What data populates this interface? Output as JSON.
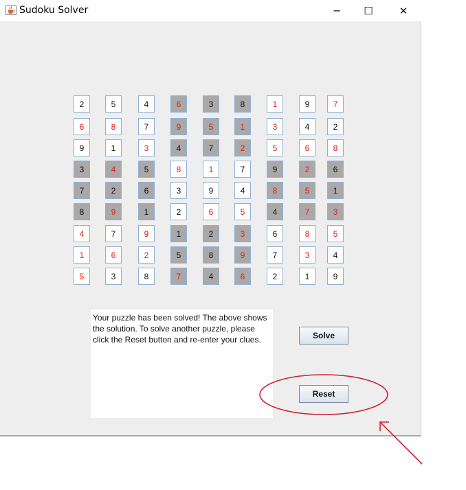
{
  "window": {
    "title": "Sudoku Solver",
    "controls": {
      "minimize": "─",
      "maximize": "☐",
      "close": "✕"
    }
  },
  "colors": {
    "given_digit": "#111111",
    "solved_digit": "#e0201c",
    "white_cell": "#ffffff",
    "gray_cell": "#a9a9a9",
    "annotation": "#d0202f"
  },
  "board": {
    "rows": [
      [
        {
          "v": "2",
          "shade": "w",
          "color": "black"
        },
        {
          "v": "5",
          "shade": "w",
          "color": "black"
        },
        {
          "v": "4",
          "shade": "w",
          "color": "black"
        },
        {
          "v": "6",
          "shade": "g",
          "color": "red"
        },
        {
          "v": "3",
          "shade": "g",
          "color": "black"
        },
        {
          "v": "8",
          "shade": "g",
          "color": "black"
        },
        {
          "v": "1",
          "shade": "w",
          "color": "red"
        },
        {
          "v": "9",
          "shade": "w",
          "color": "black"
        },
        {
          "v": "7",
          "shade": "w",
          "color": "red"
        }
      ],
      [
        {
          "v": "6",
          "shade": "w",
          "color": "red"
        },
        {
          "v": "8",
          "shade": "w",
          "color": "red"
        },
        {
          "v": "7",
          "shade": "w",
          "color": "black"
        },
        {
          "v": "9",
          "shade": "g",
          "color": "red"
        },
        {
          "v": "5",
          "shade": "g",
          "color": "red"
        },
        {
          "v": "1",
          "shade": "g",
          "color": "red"
        },
        {
          "v": "3",
          "shade": "w",
          "color": "red"
        },
        {
          "v": "4",
          "shade": "w",
          "color": "black"
        },
        {
          "v": "2",
          "shade": "w",
          "color": "black"
        }
      ],
      [
        {
          "v": "9",
          "shade": "w",
          "color": "black"
        },
        {
          "v": "1",
          "shade": "w",
          "color": "black"
        },
        {
          "v": "3",
          "shade": "w",
          "color": "red"
        },
        {
          "v": "4",
          "shade": "g",
          "color": "black"
        },
        {
          "v": "7",
          "shade": "g",
          "color": "black"
        },
        {
          "v": "2",
          "shade": "g",
          "color": "red"
        },
        {
          "v": "5",
          "shade": "w",
          "color": "red"
        },
        {
          "v": "6",
          "shade": "w",
          "color": "red"
        },
        {
          "v": "8",
          "shade": "w",
          "color": "red"
        }
      ],
      [
        {
          "v": "3",
          "shade": "g",
          "color": "black"
        },
        {
          "v": "4",
          "shade": "g",
          "color": "red"
        },
        {
          "v": "5",
          "shade": "g",
          "color": "black"
        },
        {
          "v": "8",
          "shade": "w",
          "color": "red"
        },
        {
          "v": "1",
          "shade": "w",
          "color": "red"
        },
        {
          "v": "7",
          "shade": "w",
          "color": "black"
        },
        {
          "v": "9",
          "shade": "g",
          "color": "black"
        },
        {
          "v": "2",
          "shade": "g",
          "color": "red"
        },
        {
          "v": "6",
          "shade": "g",
          "color": "black"
        }
      ],
      [
        {
          "v": "7",
          "shade": "g",
          "color": "black"
        },
        {
          "v": "2",
          "shade": "g",
          "color": "black"
        },
        {
          "v": "6",
          "shade": "g",
          "color": "black"
        },
        {
          "v": "3",
          "shade": "w",
          "color": "black"
        },
        {
          "v": "9",
          "shade": "w",
          "color": "black"
        },
        {
          "v": "4",
          "shade": "w",
          "color": "black"
        },
        {
          "v": "8",
          "shade": "g",
          "color": "red"
        },
        {
          "v": "5",
          "shade": "g",
          "color": "red"
        },
        {
          "v": "1",
          "shade": "g",
          "color": "black"
        }
      ],
      [
        {
          "v": "8",
          "shade": "g",
          "color": "black"
        },
        {
          "v": "9",
          "shade": "g",
          "color": "red"
        },
        {
          "v": "1",
          "shade": "g",
          "color": "black"
        },
        {
          "v": "2",
          "shade": "w",
          "color": "black"
        },
        {
          "v": "6",
          "shade": "w",
          "color": "red"
        },
        {
          "v": "5",
          "shade": "w",
          "color": "red"
        },
        {
          "v": "4",
          "shade": "g",
          "color": "black"
        },
        {
          "v": "7",
          "shade": "g",
          "color": "red"
        },
        {
          "v": "3",
          "shade": "g",
          "color": "red"
        }
      ],
      [
        {
          "v": "4",
          "shade": "w",
          "color": "red"
        },
        {
          "v": "7",
          "shade": "w",
          "color": "black"
        },
        {
          "v": "9",
          "shade": "w",
          "color": "red"
        },
        {
          "v": "1",
          "shade": "g",
          "color": "black"
        },
        {
          "v": "2",
          "shade": "g",
          "color": "black"
        },
        {
          "v": "3",
          "shade": "g",
          "color": "red"
        },
        {
          "v": "6",
          "shade": "w",
          "color": "black"
        },
        {
          "v": "8",
          "shade": "w",
          "color": "red"
        },
        {
          "v": "5",
          "shade": "w",
          "color": "red"
        }
      ],
      [
        {
          "v": "1",
          "shade": "w",
          "color": "red"
        },
        {
          "v": "6",
          "shade": "w",
          "color": "red"
        },
        {
          "v": "2",
          "shade": "w",
          "color": "red"
        },
        {
          "v": "5",
          "shade": "g",
          "color": "black"
        },
        {
          "v": "8",
          "shade": "g",
          "color": "black"
        },
        {
          "v": "9",
          "shade": "g",
          "color": "red"
        },
        {
          "v": "7",
          "shade": "w",
          "color": "black"
        },
        {
          "v": "3",
          "shade": "w",
          "color": "red"
        },
        {
          "v": "4",
          "shade": "w",
          "color": "black"
        }
      ],
      [
        {
          "v": "5",
          "shade": "w",
          "color": "red"
        },
        {
          "v": "3",
          "shade": "w",
          "color": "black"
        },
        {
          "v": "8",
          "shade": "w",
          "color": "black"
        },
        {
          "v": "7",
          "shade": "g",
          "color": "red"
        },
        {
          "v": "4",
          "shade": "g",
          "color": "black"
        },
        {
          "v": "6",
          "shade": "g",
          "color": "red"
        },
        {
          "v": "2",
          "shade": "w",
          "color": "black"
        },
        {
          "v": "1",
          "shade": "w",
          "color": "black"
        },
        {
          "v": "9",
          "shade": "w",
          "color": "black"
        }
      ]
    ]
  },
  "message": "Your puzzle has been solved! The above shows the solution. To solve another puzzle, please click the Reset button and re-enter your clues.",
  "buttons": {
    "solve": "Solve",
    "reset": "Reset"
  }
}
